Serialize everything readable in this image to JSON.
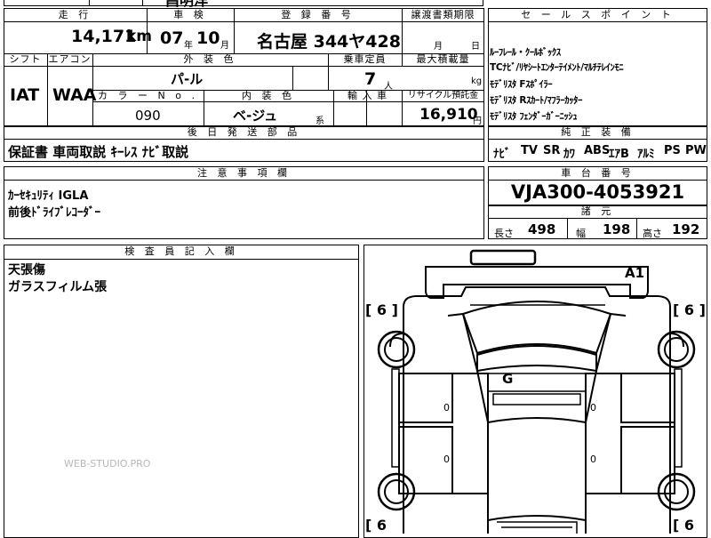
{
  "top_partial": {
    "label": "昌明洋"
  },
  "mileage": {
    "header": "走 行",
    "value": "14,171",
    "unit": "km"
  },
  "inspection": {
    "header": "車 検",
    "year": "07",
    "year_unit": "年",
    "month": "10",
    "month_unit": "月"
  },
  "registration": {
    "header": "登 録 番 号",
    "value": "名古屋 344ヤ428"
  },
  "transfer_deadline": {
    "header": "譲渡書類期限",
    "month_unit": "月",
    "day_unit": "日"
  },
  "shift": {
    "header": "シフト",
    "value": "IAT"
  },
  "aircon": {
    "header": "エアコン",
    "value": "WAA"
  },
  "exterior_color": {
    "header": "外 装 色",
    "value": "パ-ル"
  },
  "capacity": {
    "header": "乗車定員",
    "value": "7",
    "unit": "人"
  },
  "max_load": {
    "header": "最大積載量",
    "unit": "kg"
  },
  "color_no": {
    "header": "カ ラ ー N o .",
    "value": "090"
  },
  "interior_color": {
    "header": "内 装 色",
    "value": "ベ-ジュ",
    "suffix": "系"
  },
  "import_car": {
    "header": "輸 入 車"
  },
  "recycle": {
    "header": "リサイクル預託金",
    "value": "16,910",
    "unit": "円"
  },
  "retrofit": {
    "header": "後 日 発 送 部 品",
    "value": "保証書 車両取説 ｷｰﾚｽ ﾅﾋﾞ取説"
  },
  "sales_points": {
    "header": "セ ー ル ス ポ イ ン ト",
    "items": [
      "ﾙｰﾌﾚｰﾙ・ｸｰﾙﾎﾞｯｸｽ",
      "TCﾅﾋﾞ/ﾘﾔｼｰﾄｴﾝﾀｰﾃｲﾒﾝﾄ/ﾏﾙﾁﾃﾚｲﾝﾓﾆ",
      "ﾓﾃﾞﾘｽﾀ Fｽﾎﾟｲﾗｰ",
      "ﾓﾃﾞﾘｽﾀ Rｽｶｰﾄ/ﾏﾌﾗｰｶｯﾀｰ",
      "ﾓﾃﾞﾘｽﾀ ﾌｪﾝﾀﾞｰｶﾞｰﾆｯｼｭ"
    ]
  },
  "equipment": {
    "header": "純 正 装 備",
    "items": [
      "ﾅﾋﾞ",
      "TV",
      "SR",
      "ｶﾜ",
      "ABS",
      "ｴｱB",
      "ｱﾙﾐ",
      "PS",
      "PW"
    ]
  },
  "notes": {
    "header": "注 意 事 項 欄",
    "lines": [
      "ｶｰｾｷｭﾘﾃｨ IGLA",
      "前後ﾄﾞﾗｲﾌﾞﾚｺｰﾀﾞｰ"
    ]
  },
  "chassis": {
    "header": "車 台 番 号",
    "value": "VJA300-4053921"
  },
  "specs": {
    "header": "諸 元",
    "length_label": "長さ",
    "length": "498",
    "width_label": "幅",
    "width": "198",
    "height_label": "高さ",
    "height": "192"
  },
  "inspector": {
    "header": "検 査 員 記 入 欄",
    "lines": [
      "天張傷",
      "ガラスフィルム張"
    ]
  },
  "watermark": "WEB-STUDIO.PRO",
  "diagram": {
    "marks": [
      "A1",
      "G"
    ],
    "tire_labels": [
      "[ 6 ]",
      "[ 6 ]",
      "[ 6",
      "[ 6"
    ],
    "door_zeros": [
      "0",
      "0",
      "0",
      "0"
    ]
  }
}
